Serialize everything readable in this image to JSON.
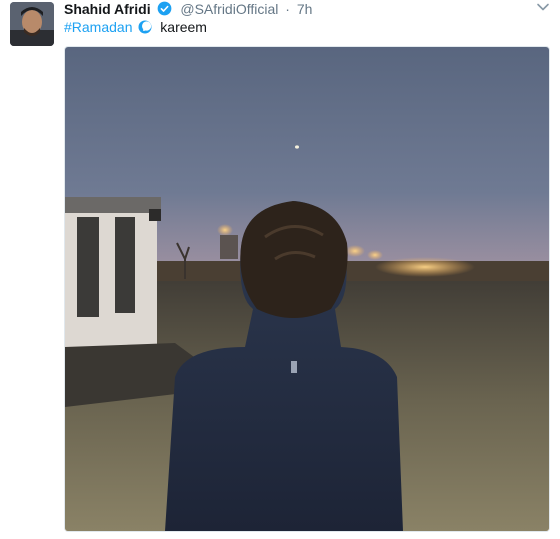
{
  "tweet": {
    "author_name": "Shahid Afridi",
    "handle": "@SAfridiOfficial",
    "separator": "·",
    "timestamp": "7h",
    "hashtag": "#Ramadan",
    "text_after": "kareem"
  },
  "icons": {
    "verified": "verified-badge-icon",
    "emoji": "ramadan-emoji-icon",
    "menu": "chevron-down-icon"
  },
  "colors": {
    "name": "#14171a",
    "secondary": "#657786",
    "link": "#1da1f2",
    "verified": "#1da1f2",
    "border": "#e1e8ed"
  }
}
